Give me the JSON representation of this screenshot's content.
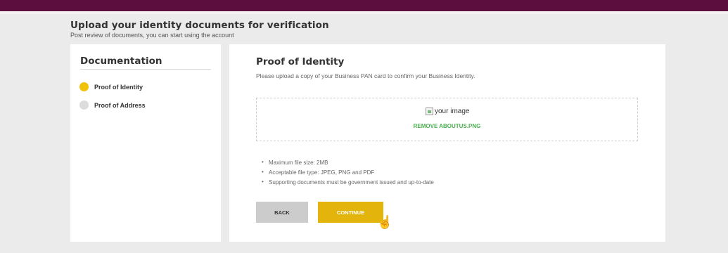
{
  "header": {
    "title": "Upload your identity documents for verification",
    "subtitle": "Post review of documents, you can start using the account"
  },
  "sidebar": {
    "title": "Documentation",
    "items": [
      {
        "label": "Proof of Identity",
        "status": "active",
        "color": "#f0c20a"
      },
      {
        "label": "Proof of Address",
        "status": "inactive",
        "color": "#dcdcdc"
      }
    ]
  },
  "main": {
    "title": "Proof of Identity",
    "description": "Please upload a copy of your Business PAN card to confirm your Business Identity.",
    "upload": {
      "image_alt": "your image",
      "remove_label": "REMOVE ABOUTUS.PNG"
    },
    "requirements": [
      "Maximum file size: 2MB",
      "Acceptable file type: JPEG, PNG and PDF",
      "Supporting documents must be government issued and up-to-date"
    ],
    "buttons": {
      "back": "BACK",
      "continue": "CONTINUE"
    }
  },
  "colors": {
    "brand_bar": "#5c0f3e",
    "accent": "#e3b40b",
    "remove_link": "#4caf50"
  },
  "icons": [
    "broken-image-icon",
    "hand-pointer-cursor-icon"
  ]
}
